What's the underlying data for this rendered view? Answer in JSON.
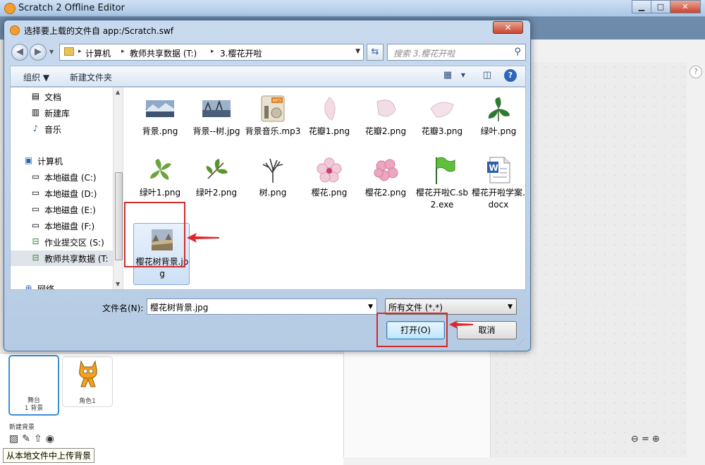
{
  "app": {
    "window_title": "Scratch 2 Offline Editor",
    "window_buttons": [
      "▁",
      "□",
      "✕"
    ]
  },
  "dialog": {
    "title": "选择要上载的文件自 app:/Scratch.swf",
    "close_label": "✕",
    "breadcrumbs": [
      "计算机",
      "教师共享数据 (T:)",
      "3.樱花开啦"
    ],
    "search_placeholder": "搜索 3.樱花开啦",
    "toolbar": {
      "organize": "组织 ▼",
      "new_folder": "新建文件夹"
    },
    "nav_items": [
      {
        "label": "文档",
        "icon": "document-icon"
      },
      {
        "label": "新建库",
        "icon": "library-icon"
      },
      {
        "label": "音乐",
        "icon": "music-icon"
      },
      {
        "label": "计算机",
        "icon": "computer-icon"
      },
      {
        "label": "本地磁盘 (C:)",
        "icon": "drive-icon"
      },
      {
        "label": "本地磁盘 (D:)",
        "icon": "drive-icon"
      },
      {
        "label": "本地磁盘 (E:)",
        "icon": "drive-icon"
      },
      {
        "label": "本地磁盘 (F:)",
        "icon": "drive-icon"
      },
      {
        "label": "作业提交区 (S:)",
        "icon": "network-drive-icon"
      },
      {
        "label": "教师共享数据 (T:",
        "icon": "network-drive-icon",
        "selected": true
      },
      {
        "label": "网络",
        "icon": "network-icon"
      }
    ],
    "files": [
      {
        "name": "背景.png",
        "kind": "landscape"
      },
      {
        "name": "背景--树.jpg",
        "kind": "landscape2"
      },
      {
        "name": "背景音乐.mp3",
        "kind": "mp3"
      },
      {
        "name": "花瓣1.png",
        "kind": "petal"
      },
      {
        "name": "花瓣2.png",
        "kind": "petal"
      },
      {
        "name": "花瓣3.png",
        "kind": "petal"
      },
      {
        "name": "绿叶.png",
        "kind": "leaf"
      },
      {
        "name": "绿叶1.png",
        "kind": "leaf"
      },
      {
        "name": "绿叶2.png",
        "kind": "leaf"
      },
      {
        "name": "树.png",
        "kind": "tree"
      },
      {
        "name": "樱花.png",
        "kind": "blossom"
      },
      {
        "name": "樱花2.png",
        "kind": "blossom"
      },
      {
        "name": "樱花开啦C.sb2.exe",
        "kind": "flag"
      },
      {
        "name": "樱花开啦学案.docx",
        "kind": "docx"
      },
      {
        "name": "樱花树背景.jpg",
        "kind": "photo",
        "selected": true
      }
    ],
    "filename_label": "文件名(N):",
    "filename_value": "樱花树背景.jpg",
    "filetype_value": "所有文件 (*.*)",
    "open_label": "打开(O)",
    "cancel_label": "取消"
  },
  "scratch": {
    "stage_label": "舞台",
    "stage_sub": "1 背景",
    "sprite_label": "角色1",
    "new_backdrop_label": "新建背景",
    "tooltip": "从本地文件中上传背景"
  },
  "colors": {
    "accent": "#3c7fb1",
    "highlight_box": "#d12b2b",
    "selection": "#cde0f6"
  }
}
